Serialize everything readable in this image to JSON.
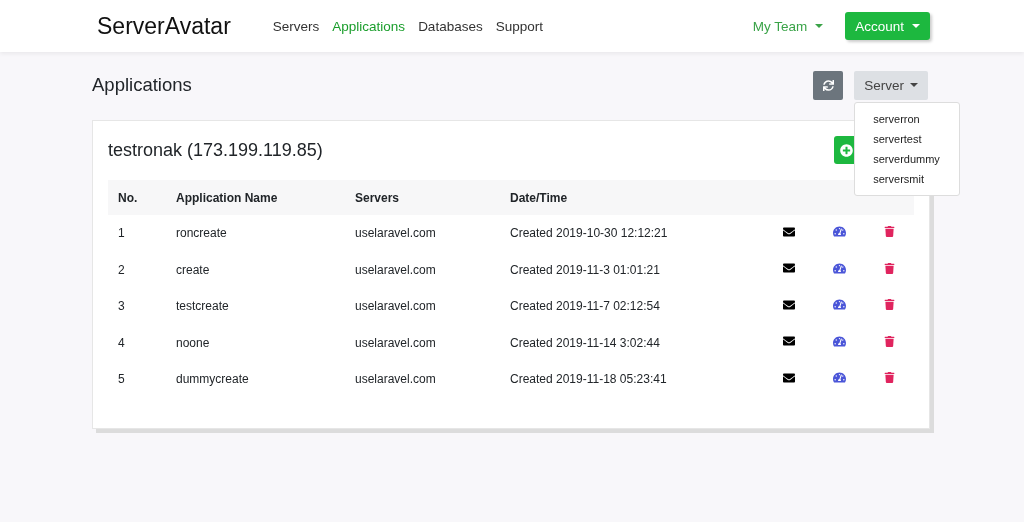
{
  "brand": "ServerAvatar",
  "nav": [
    {
      "label": "Servers",
      "selected": false
    },
    {
      "label": "Applications",
      "selected": true
    },
    {
      "label": "Databases",
      "selected": false
    },
    {
      "label": "Support",
      "selected": false
    }
  ],
  "team_menu": "My Team",
  "account_button": "Account",
  "page_title": "Applications",
  "server_filter": "Server",
  "server_menu": [
    "serverron",
    "servertest",
    "serverdummy",
    "serversmit"
  ],
  "card_title": "testronak (173.199.119.85)",
  "table": {
    "columns": [
      "No.",
      "Application Name",
      "Servers",
      "Date/Time"
    ],
    "rows": [
      {
        "no": "1",
        "name": "roncreate",
        "server": "uselaravel.com",
        "date": "Created 2019-10-30 12:12:21"
      },
      {
        "no": "2",
        "name": "create",
        "server": "uselaravel.com",
        "date": "Created 2019-11-3 01:01:21"
      },
      {
        "no": "3",
        "name": "testcreate",
        "server": "uselaravel.com",
        "date": "Created 2019-11-7 02:12:54"
      },
      {
        "no": "4",
        "name": "noone",
        "server": "uselaravel.com",
        "date": "Created 2019-11-14 3:02:44"
      },
      {
        "no": "5",
        "name": "dummycreate",
        "server": "uselaravel.com",
        "date": "Created 2019-11-18 05:23:41"
      }
    ]
  }
}
